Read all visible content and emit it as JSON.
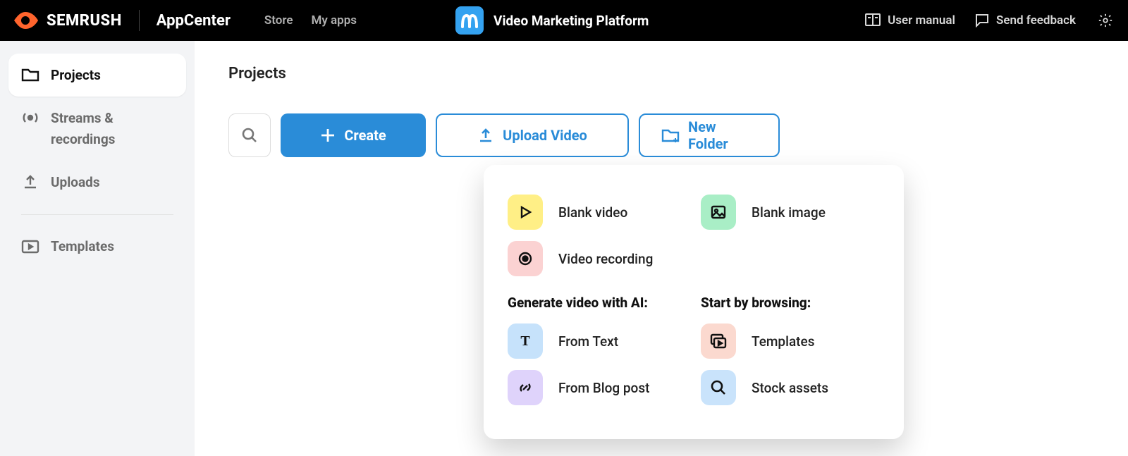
{
  "header": {
    "brand_name": "SEMRUSH",
    "appcenter_label": "AppCenter",
    "nav": {
      "store": "Store",
      "my_apps": "My apps"
    },
    "app_title": "Video Marketing Platform",
    "user_manual": "User manual",
    "send_feedback": "Send feedback"
  },
  "sidebar": {
    "projects": "Projects",
    "streams": "Streams & recordings",
    "uploads": "Uploads",
    "templates": "Templates"
  },
  "main": {
    "title": "Projects",
    "create": "Create",
    "upload": "Upload Video",
    "new_folder": "New Folder"
  },
  "dropdown": {
    "blank_video": "Blank video",
    "blank_image": "Blank image",
    "video_recording": "Video recording",
    "heading_ai": "Generate video with AI:",
    "heading_browse": "Start by browsing:",
    "from_text": "From Text",
    "from_blog": "From Blog post",
    "templates": "Templates",
    "stock_assets": "Stock assets"
  }
}
